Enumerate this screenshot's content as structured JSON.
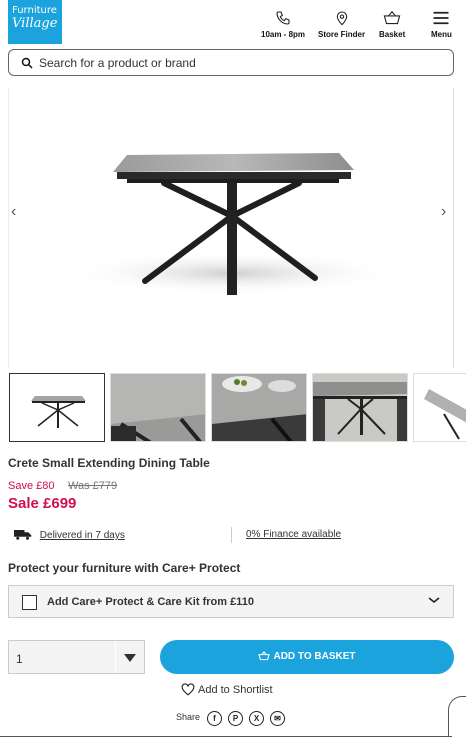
{
  "header": {
    "logo_line1": "Furniture",
    "logo_line2": "Village",
    "items": [
      {
        "label": "10am - 8pm",
        "icon": "phone-icon"
      },
      {
        "label": "Store Finder",
        "icon": "location-pin-icon"
      },
      {
        "label": "Basket",
        "icon": "basket-icon"
      },
      {
        "label": "Menu",
        "icon": "hamburger-menu-icon"
      }
    ]
  },
  "search": {
    "placeholder": "Search for a product or brand"
  },
  "product": {
    "title": "Crete Small Extending Dining Table",
    "save": "Save £80",
    "was": "Was £779",
    "sale": "Sale £699"
  },
  "info": {
    "delivery": "Delivered in 7 days",
    "finance": "0% Finance available"
  },
  "protect": {
    "heading": "Protect your furniture with Care+ Protect",
    "option": "Add Care+ Protect & Care Kit from £110"
  },
  "purchase": {
    "quantity": "1",
    "add_to_basket": "ADD TO BASKET",
    "shortlist": "Add to Shortlist",
    "share": "Share"
  },
  "colors": {
    "brand": "#1aa3dc",
    "sale": "#d0104c"
  }
}
